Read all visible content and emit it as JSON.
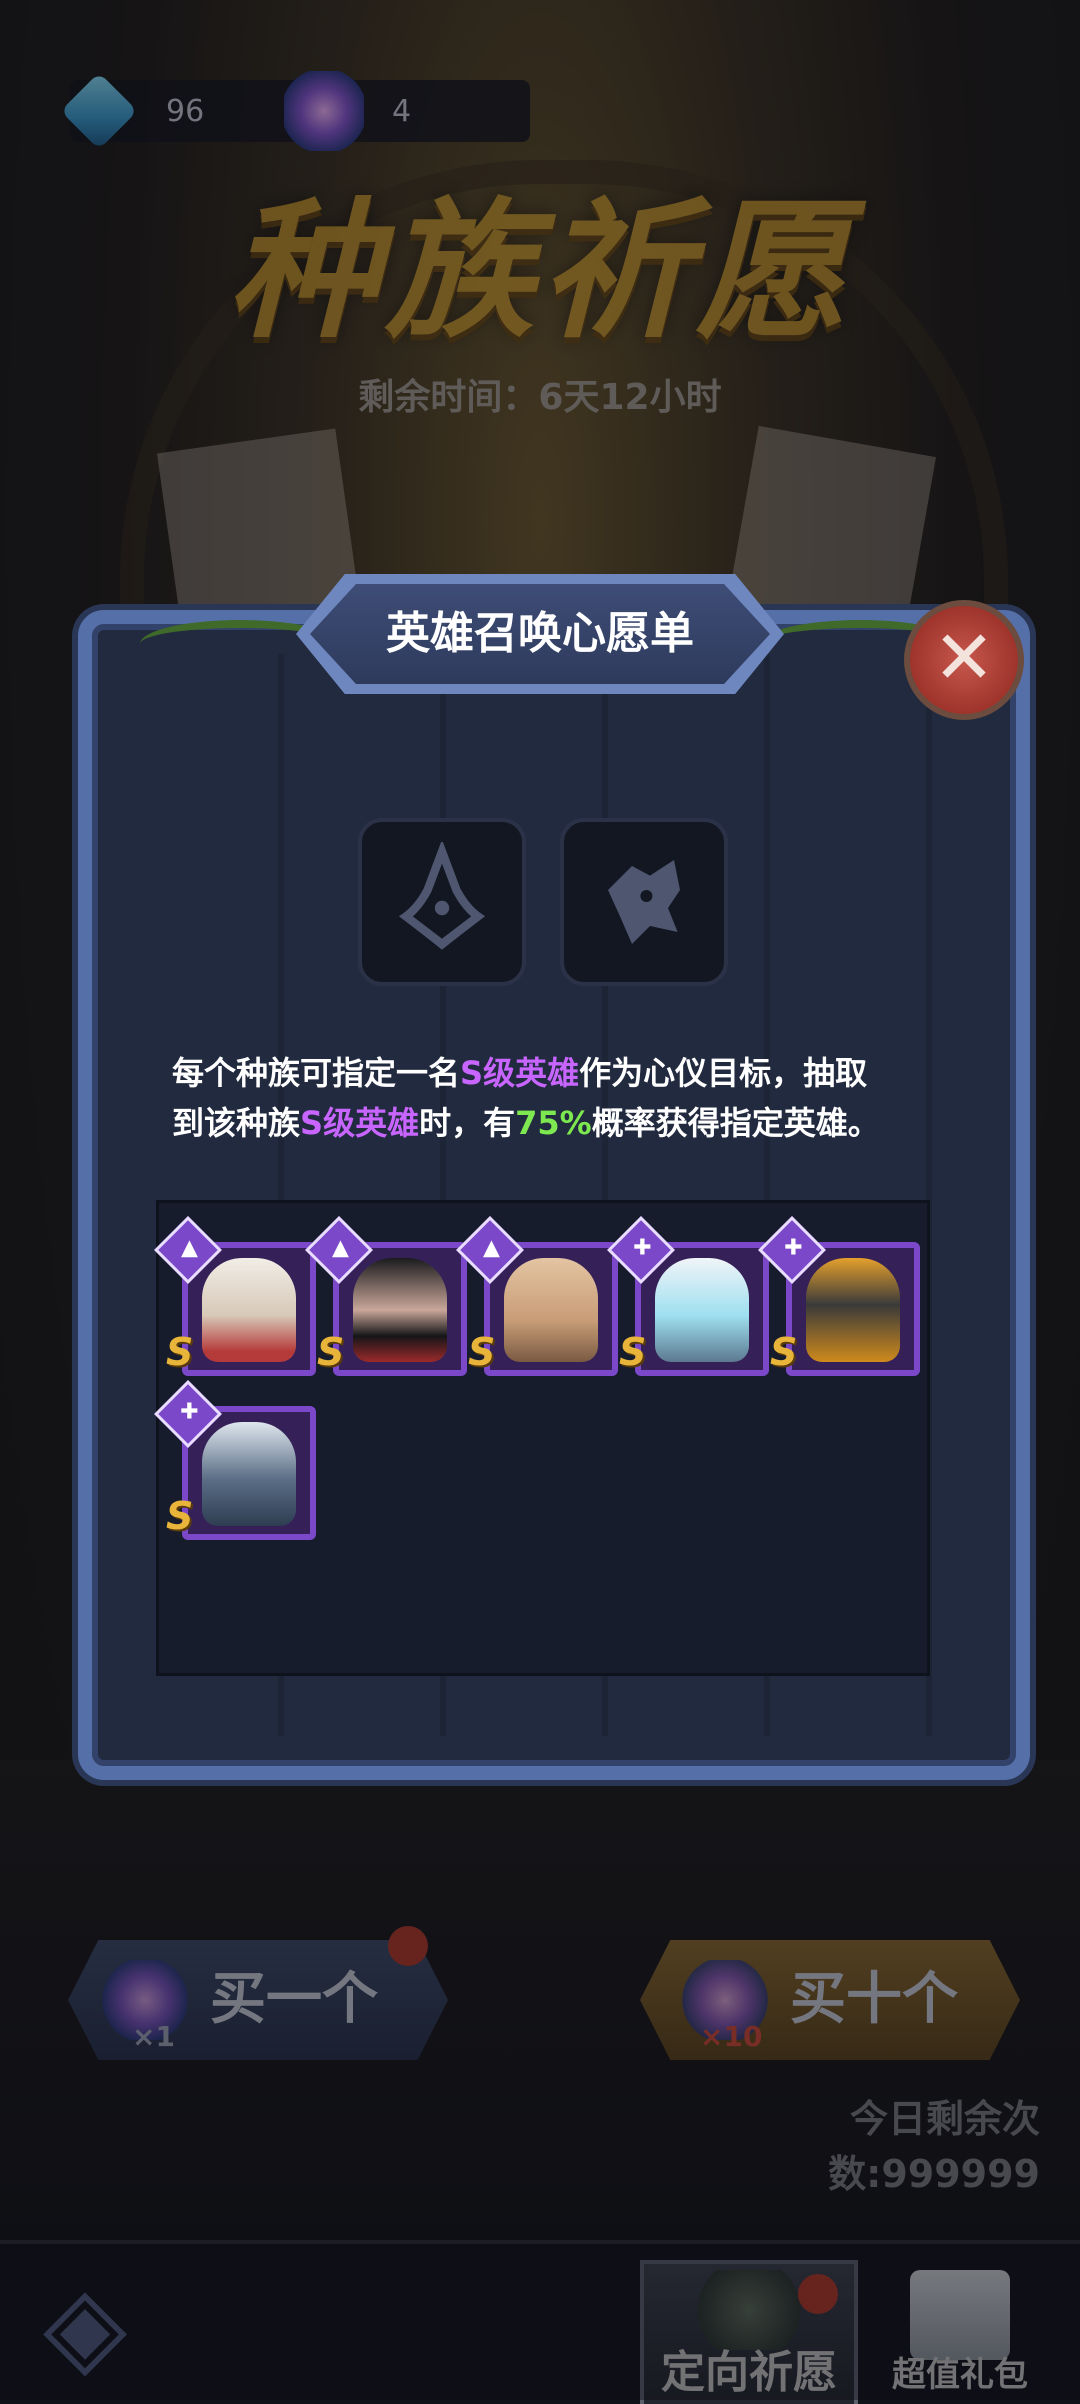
{
  "currencies": {
    "diamond": {
      "icon": "diamond-plus-icon",
      "value": "96"
    },
    "crystal": {
      "icon": "star-crystal-icon",
      "value": "4"
    }
  },
  "event": {
    "title": "种族祈愿",
    "remaining_time": "剩余时间：6天12小时"
  },
  "modal": {
    "title": "英雄召唤心愿单",
    "close_icon": "close-x-icon",
    "race_slots": [
      {
        "icon": "wizard-hat-icon"
      },
      {
        "icon": "wolf-head-icon"
      }
    ],
    "description": {
      "line1_pre": "每个种族可指定一名",
      "line1_highlight": "S级英雄",
      "line1_post": "作为心仪目标，抽取",
      "line2_pre": "到该种族",
      "line2_highlight": "S级英雄",
      "line2_mid": "时，有",
      "line2_percent": "75%",
      "line2_post": "概率获得指定英雄。"
    },
    "heroes": [
      {
        "race_icon": "wizard-hat-icon",
        "grade": "S",
        "portrait": "white-haired-queen"
      },
      {
        "race_icon": "wizard-hat-icon",
        "grade": "S",
        "portrait": "masked-ninja"
      },
      {
        "race_icon": "wizard-hat-icon",
        "grade": "S",
        "portrait": "bald-warrior"
      },
      {
        "race_icon": "wrench-icon",
        "grade": "S",
        "portrait": "white-robot"
      },
      {
        "race_icon": "wrench-icon",
        "grade": "S",
        "portrait": "gold-robot"
      },
      {
        "race_icon": "wrench-icon",
        "grade": "S",
        "portrait": "silver-mech"
      }
    ],
    "colors": {
      "purple_highlight": "#c865ff",
      "green_highlight": "#7de84f"
    }
  },
  "actions": {
    "buy_one": {
      "label": "买一个",
      "multiplier": "×1"
    },
    "buy_ten": {
      "label": "买十个",
      "multiplier": "×10"
    },
    "today_remaining": "今日剩余次数:999999"
  },
  "bottom_nav": {
    "back_icon": "back-arrow-icon",
    "tabs": [
      {
        "label": "定向祈愿",
        "icon": "wish-tree-icon",
        "active": true
      },
      {
        "label": "超值礼包",
        "icon": "gift-box-icon",
        "active": false
      }
    ]
  }
}
